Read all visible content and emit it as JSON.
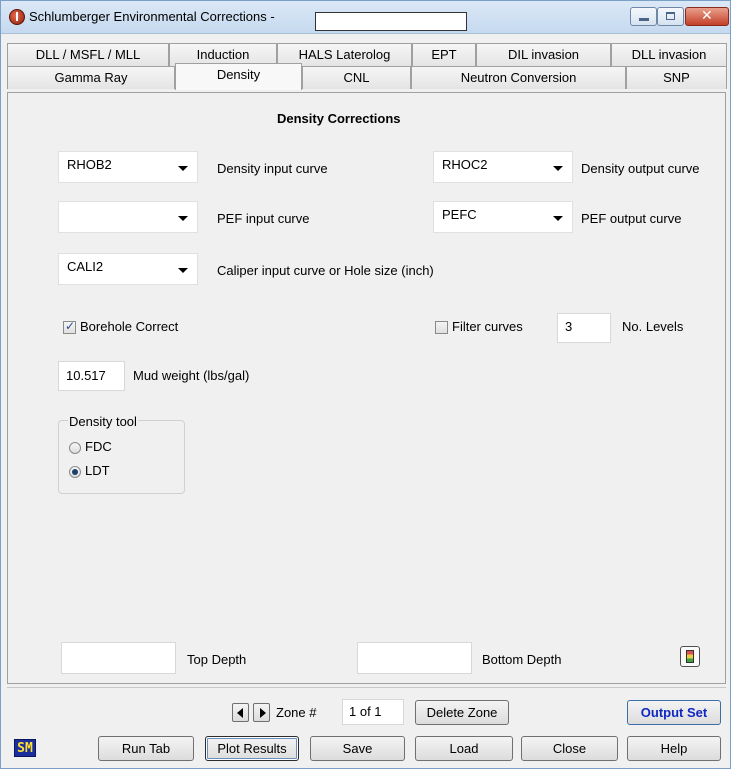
{
  "window": {
    "title": "Schlumberger Environmental Corrections -",
    "title_field_value": ""
  },
  "tabs": {
    "row1": [
      "DLL / MSFL / MLL",
      "Induction",
      "HALS Laterolog",
      "EPT",
      "DIL invasion",
      "DLL invasion"
    ],
    "row2": [
      "Gamma Ray",
      "Density",
      "CNL",
      "Neutron Conversion",
      "SNP"
    ],
    "active": "Density"
  },
  "panel": {
    "heading": "Density Corrections",
    "density_input": {
      "value": "RHOB2",
      "label": "Density input curve"
    },
    "density_output": {
      "value": "RHOC2",
      "label": "Density output curve"
    },
    "pef_input": {
      "value": "",
      "label": "PEF input curve"
    },
    "pef_output": {
      "value": "PEFC",
      "label": "PEF output curve"
    },
    "caliper_input": {
      "value": "CALI2",
      "label": "Caliper input curve or Hole size (inch)"
    },
    "borehole_correct": {
      "label": "Borehole Correct",
      "checked": true
    },
    "filter_curves": {
      "label": "Filter curves",
      "checked": false
    },
    "levels": {
      "value": "3",
      "label": "No. Levels"
    },
    "mud_weight": {
      "value": "10.517",
      "label": "Mud weight (lbs/gal)"
    },
    "density_tool": {
      "title": "Density tool",
      "options": [
        "FDC",
        "LDT"
      ],
      "selected": "LDT"
    },
    "top_depth": {
      "value": "",
      "label": "Top Depth"
    },
    "bottom_depth": {
      "value": "",
      "label": "Bottom Depth"
    }
  },
  "footer": {
    "zone_label": "Zone #",
    "zone_value": "1 of 1",
    "delete_zone": "Delete Zone",
    "output_set": "Output Set",
    "logo": "SM",
    "buttons": {
      "run_tab": "Run Tab",
      "plot_results": "Plot Results",
      "save": "Save",
      "load": "Load",
      "close": "Close",
      "help": "Help"
    }
  }
}
